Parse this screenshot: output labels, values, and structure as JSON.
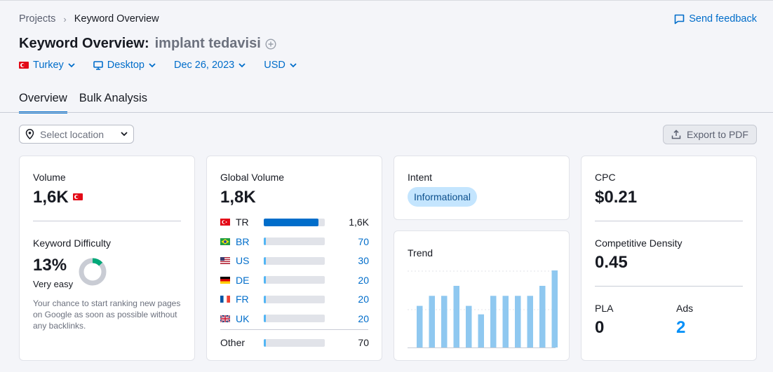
{
  "breadcrumb": {
    "parent": "Projects",
    "separator": "›",
    "current": "Keyword Overview"
  },
  "feedback": {
    "label": "Send feedback"
  },
  "title": {
    "prefix": "Keyword Overview:",
    "keyword": "implant tedavisi"
  },
  "filters": {
    "country": "Turkey",
    "device": "Desktop",
    "date": "Dec 26, 2023",
    "currency": "USD"
  },
  "tabs": [
    {
      "label": "Overview",
      "active": true
    },
    {
      "label": "Bulk Analysis",
      "active": false
    }
  ],
  "location": {
    "placeholder": "Select location"
  },
  "export": {
    "label": "Export to PDF"
  },
  "volume": {
    "label": "Volume",
    "value": "1,6K"
  },
  "keyword_difficulty": {
    "label": "Keyword Difficulty",
    "value": "13%",
    "percent": 13,
    "level": "Very easy",
    "description": "Your chance to start ranking new pages on Google as soon as possible without any backlinks."
  },
  "global_volume": {
    "label": "Global Volume",
    "value": "1,8K",
    "rows": [
      {
        "code": "TR",
        "value": "1,6K",
        "fill": 0.9,
        "link": false
      },
      {
        "code": "BR",
        "value": "70",
        "fill": 0.04,
        "link": true
      },
      {
        "code": "US",
        "value": "30",
        "fill": 0.03,
        "link": true
      },
      {
        "code": "DE",
        "value": "20",
        "fill": 0.03,
        "link": true
      },
      {
        "code": "FR",
        "value": "20",
        "fill": 0.03,
        "link": true
      },
      {
        "code": "UK",
        "value": "20",
        "fill": 0.03,
        "link": true
      }
    ],
    "other": {
      "label": "Other",
      "value": "70",
      "fill": 0.04
    }
  },
  "intent": {
    "label": "Intent",
    "value": "Informational"
  },
  "trend": {
    "label": "Trend",
    "bars": [
      0.54,
      0.67,
      0.67,
      0.8,
      0.54,
      0.43,
      0.67,
      0.67,
      0.67,
      0.67,
      0.8,
      1.0
    ]
  },
  "cpc": {
    "label": "CPC",
    "value": "$0.21"
  },
  "competitive_density": {
    "label": "Competitive Density",
    "value": "0.45"
  },
  "pla": {
    "label": "PLA",
    "value": "0"
  },
  "ads": {
    "label": "Ads",
    "value": "2"
  },
  "colors": {
    "accent": "#006dca",
    "bar_primary": "#006dca",
    "bar_secondary": "#52b5f4",
    "trend_bar": "#8fc8f0",
    "kd_green": "#00a878",
    "intent_bg": "#c4e5fe"
  }
}
